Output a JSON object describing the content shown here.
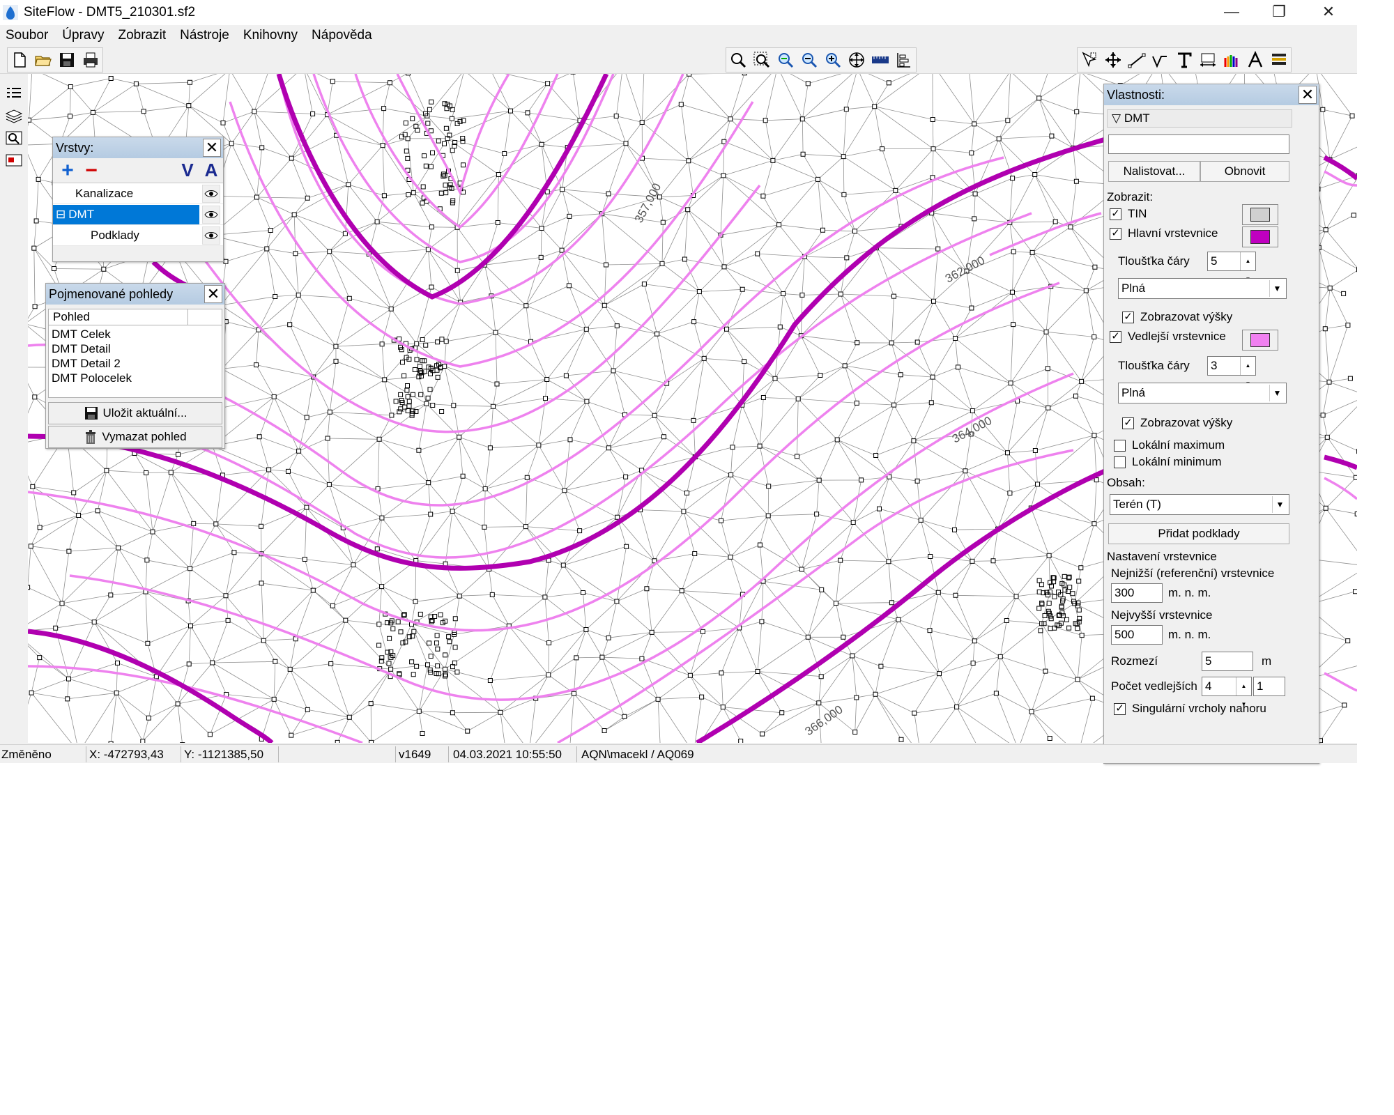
{
  "window": {
    "title": "SiteFlow - DMT5_210301.sf2",
    "minimize_glyph": "—",
    "maximize_glyph": "❐",
    "close_glyph": "✕"
  },
  "menu": {
    "items": [
      "Soubor",
      "Úpravy",
      "Zobrazit",
      "Nástroje",
      "Knihovny",
      "Nápověda"
    ]
  },
  "toolbar": {
    "file_icons": [
      "new-file-icon",
      "open-folder-icon",
      "save-icon",
      "print-icon"
    ],
    "view_icons": [
      "zoom-icon",
      "zoom-window-icon",
      "zoom-in-icon",
      "zoom-out-icon",
      "zoom-all-icon",
      "pan-icon",
      "ruler-icon",
      "properties-icon"
    ],
    "draw_icons": [
      "select-icon",
      "move-icon",
      "line-icon",
      "polyline-icon",
      "text-icon",
      "dimension-icon",
      "rainbow-icon",
      "font-icon",
      "layers-stack-icon"
    ]
  },
  "map": {
    "contour_labels": [
      "357,000",
      "362,000",
      "364,000",
      "366,000"
    ],
    "major_contour_color": "#b000b0",
    "minor_contour_color": "#ee82ee",
    "tin_color": "#909090"
  },
  "layers_panel": {
    "title": "Vrstvy:",
    "close_glyph": "✕",
    "add_glyph": "+",
    "remove_glyph": "−",
    "move_down_glyph": "V",
    "move_up_glyph": "A",
    "tree_expander": "⊟",
    "layers": [
      {
        "name": "Kanalizace",
        "selected": false
      },
      {
        "name": "DMT",
        "selected": true
      },
      {
        "name": "Podklady",
        "selected": false
      }
    ]
  },
  "views_panel": {
    "title": "Pojmenované pohledy",
    "close_glyph": "✕",
    "column_header": "Pohled",
    "views": [
      "DMT Celek",
      "DMT Detail",
      "DMT Detail 2",
      "DMT Polocelek"
    ],
    "save_label": "Uložit aktuální...",
    "delete_label": "Vymazat pohled"
  },
  "properties_panel": {
    "title": "Vlastnosti:",
    "close_glyph": "✕",
    "section": "DMT",
    "section_glyph": "▽",
    "name_value": "",
    "setup_button": "Nalistovat...",
    "refresh_button": "Obnovit",
    "display_label": "Zobrazit:",
    "tin_label": "TIN",
    "tin_checked": true,
    "tin_color": "#d0d0d0",
    "main_contours_label": "Hlavní vrstevnice",
    "main_contours_checked": true,
    "main_contours_color": "#c000c0",
    "line_thickness_label": "Tloušťka čáry",
    "main_thickness": "5",
    "main_linestyle": "Plná",
    "main_show_heights_label": "Zobrazovat výšky",
    "main_show_heights_checked": true,
    "minor_contours_label": "Vedlejší vrstevnice",
    "minor_contours_checked": true,
    "minor_contours_color": "#f080f0",
    "minor_thickness": "3",
    "minor_linestyle": "Plná",
    "minor_show_heights_label": "Zobrazovat výšky",
    "minor_show_heights_checked": true,
    "local_max_label": "Lokální maximum",
    "local_max_checked": false,
    "local_min_label": "Lokální minimum",
    "local_min_checked": false,
    "content_label": "Obsah:",
    "content_value": "Terén (T)",
    "add_base_button": "Přidat podklady",
    "contour_settings_label": "Nastavení vrstevnice",
    "lowest_label": "Nejnižší (referenční) vrstevnice",
    "lowest_value": "300",
    "unit_mnm": "m. n. m.",
    "highest_label": "Nejvyšší vrstevnice",
    "highest_value": "500",
    "interval_label": "Rozmezí",
    "interval_value": "5",
    "interval_unit": "m",
    "minor_count_label": "Počet vedlejších",
    "minor_count_value": "4",
    "minor_count_extra": "1",
    "singular_label": "Singulární vrcholy nahoru",
    "singular_checked": true,
    "check_glyph": "✓",
    "dropdown_glyph": "▼",
    "spin_up": "▲",
    "spin_down": "▼"
  },
  "statusbar": {
    "state": "Změněno",
    "x": "X: -472793,43",
    "y": "Y: -1121385,50",
    "empty": "",
    "version": "v1649",
    "datetime": "04.03.2021 10:55:50",
    "user": "AQN\\macekl / AQ069"
  }
}
